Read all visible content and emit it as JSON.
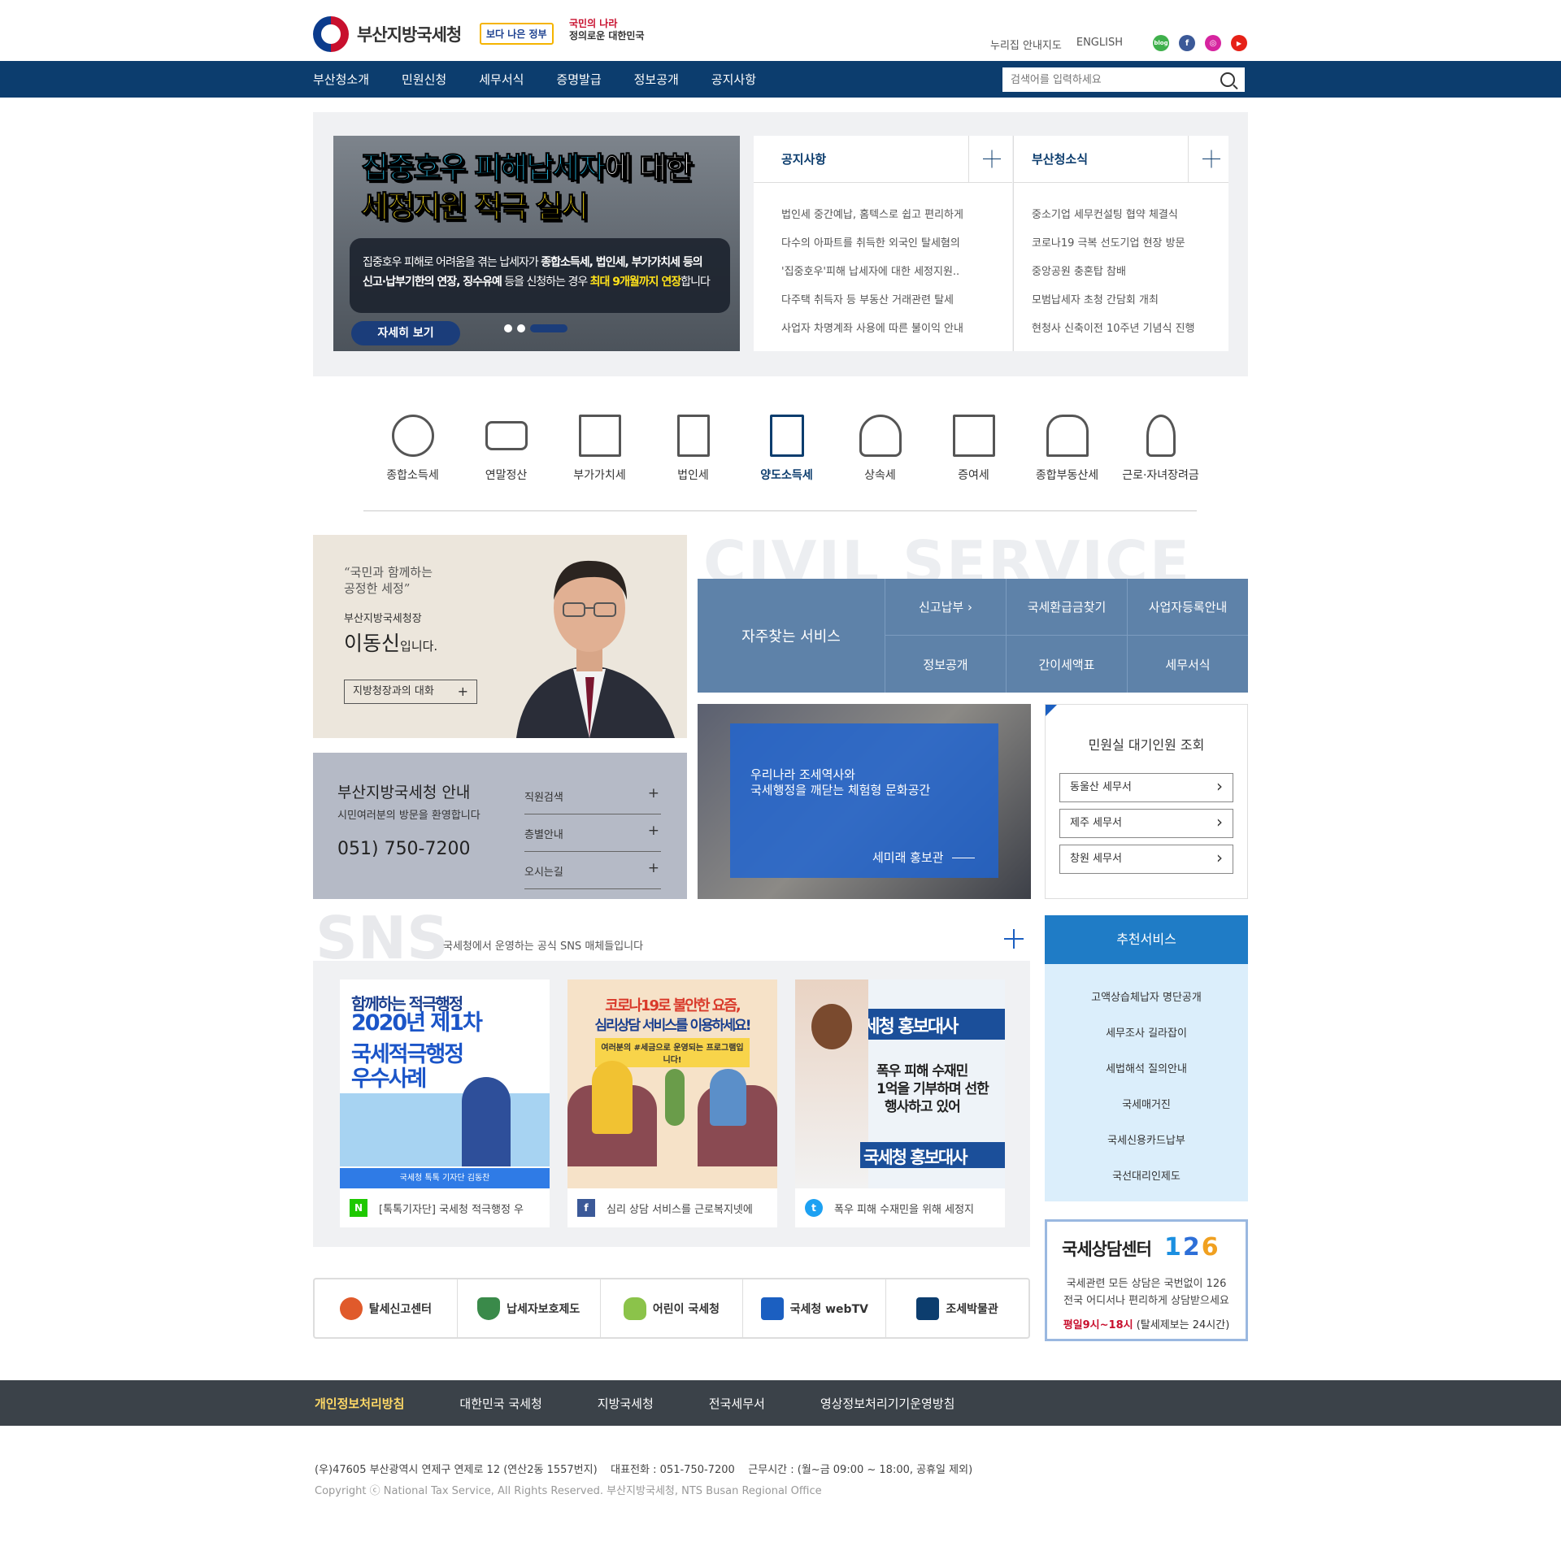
{
  "header": {
    "org_name": "부산지방국세청",
    "slogan1": "보다 나은 정부",
    "slogan2_line1": "국민의 나라",
    "slogan2_line2": "정의로운 대한민국",
    "links": [
      "누리집 안내지도",
      "ENGLISH"
    ],
    "sns": [
      {
        "name": "blog",
        "label": "blog",
        "color": "#3fb04c"
      },
      {
        "name": "facebook",
        "label": "f",
        "color": "#3b5998"
      },
      {
        "name": "instagram",
        "label": "◎",
        "color": "#d6249f"
      },
      {
        "name": "youtube",
        "label": "▶",
        "color": "#e62117"
      }
    ]
  },
  "nav": {
    "items": [
      "부산청소개",
      "민원신청",
      "세무서식",
      "증명발급",
      "정보공개",
      "공지사항"
    ],
    "search_placeholder": "검색어를 입력하세요"
  },
  "banner": {
    "title_part1": "집중호우 피해납세자",
    "title_part2": "에 대한",
    "title_line2": "세정지원 적극 실시",
    "desc_line1_a": "집중호우 피해로 어려움을 겪는 납세자가 ",
    "desc_line1_b": "종합소득세, 법인세, 부가가치세 등의",
    "desc_line2_a": "신고·납부기한의 연장, 징수유예",
    "desc_line2_b": " 등을 신청하는 경우 ",
    "desc_line2_c": "최대 9개월까지 연장",
    "desc_line2_d": "합니다",
    "more_label": "자세히 보기"
  },
  "notice": {
    "title": "공지사항",
    "items": [
      "법인세 중간예납, 홈텍스로 쉽고 편리하게",
      "다수의 아파트를 취득한 외국인 탈세혐의",
      "'집중호우'피해 납세자에 대한 세정지원..",
      "다주택 취득자 등  부동산 거래관련 탈세",
      "사업자 차명계좌 사용에 따른 불이익 안내"
    ]
  },
  "news": {
    "title": "부산청소식",
    "items": [
      "중소기업 세무컨설팅 협약 체결식",
      "코로나19 극복 선도기업 현장 방문",
      "중앙공원 충혼탑 참배",
      "모범납세자 초청 간담회 개최",
      "현청사 신축이전 10주년 기념식 진행"
    ]
  },
  "tax_menu": [
    {
      "label": "종합소득세",
      "icon": "money-bag-icon",
      "active": false
    },
    {
      "label": "연말정산",
      "icon": "card-icon",
      "active": false
    },
    {
      "label": "부가가치세",
      "icon": "store-icon",
      "active": false
    },
    {
      "label": "법인세",
      "icon": "building-icon",
      "active": false
    },
    {
      "label": "양도소득세",
      "icon": "document-icon",
      "active": true
    },
    {
      "label": "상속세",
      "icon": "hand-coin-icon",
      "active": false
    },
    {
      "label": "증여세",
      "icon": "gift-icon",
      "active": false
    },
    {
      "label": "종합부동산세",
      "icon": "house-icon",
      "active": false
    },
    {
      "label": "근로·자녀장려금",
      "icon": "lightbulb-icon",
      "active": false
    }
  ],
  "commissioner": {
    "quote_line1": "“국민과 함께하는",
    "quote_line2": "공정한 세정”",
    "title": "부산지방국세청장",
    "name": "이동신",
    "name_suffix": "입니다.",
    "button": "지방청장과의 대화"
  },
  "civil": {
    "bg_text": "CIVIL SERVICE",
    "label": "자주찾는 서비스",
    "items": [
      "신고납부 ›",
      "국세환급금찾기",
      "사업자등록안내",
      "정보공개",
      "간이세액표",
      "세무서식"
    ]
  },
  "info": {
    "title": "부산지방국세청 안내",
    "subtitle": "시민여러분의 방문을 환영합니다",
    "phone": "051) 750-7200",
    "links": [
      "직원검색",
      "층별안내",
      "오시는길"
    ]
  },
  "museum": {
    "line1": "우리나라 조세역사와",
    "line2": "국세행정을 깨닫는 체험형 문화공간",
    "link": "세미래 홍보관"
  },
  "waiting": {
    "title": "민원실 대기인원 조회",
    "offices": [
      "동울산 세무서",
      "제주 세무서",
      "창원 세무서"
    ]
  },
  "sns": {
    "heading": "SNS",
    "subtitle": "국세청에서 운영하는 공식 SNS 매체들입니다",
    "cards": [
      {
        "platform": "N",
        "color": "#1ec800",
        "caption": "[톡톡기자단] 국세청 적극행정 우",
        "img_line1": "함께하는 적극행정",
        "img_line2": "2020년 제1차",
        "img_line3": "국세적극행정",
        "img_line4": "우수사례",
        "img_footer": "국세청 톡톡 기자단 김동찬"
      },
      {
        "platform": "f",
        "color": "#3b5998",
        "caption": "심리 상담 서비스를 근로복지넷에",
        "img_line1": "코로나19로 불안한 요즘,",
        "img_line2": "심리상담 서비스를 이용하세요!",
        "img_line3": "여러분의 #세금으로 운영되는 프로그램입니다!"
      },
      {
        "platform": "t",
        "color": "#1da1f2",
        "caption": "폭우 피해 수재민을 위해 세정지",
        "img_line1": "국세청 홍보대사",
        "img_line2": "폭우 피해 수재민",
        "img_line3": "1억을 기부하며 선한",
        "img_line4": "행사하고 있어",
        "img_line5": "국세청 홍보대사"
      }
    ]
  },
  "recommend": {
    "title": "추천서비스",
    "items": [
      "고액상습체납자 명단공개",
      "세무조사 길라잡이",
      "세법해석 질의안내",
      "국세매거진",
      "국세신용카드납부",
      "국선대리인제도"
    ]
  },
  "center126": {
    "title": "국세상담센터",
    "number": "126",
    "desc_line1": "국세관련 모든 상담은 국번없이 126",
    "desc_line2": "전국 어디서나 편리하게 상담받으세요",
    "hours": "평일9시~18시",
    "hours_note": " (탈세제보는 24시간)"
  },
  "quick_banners": [
    {
      "label": "탈세신고센터",
      "color": "#e05a2b"
    },
    {
      "label": "납세자보호제도",
      "color": "#3a8a4a"
    },
    {
      "label": "어린이 국세청",
      "color": "#8bc34a"
    },
    {
      "label": "국세청 webTV",
      "color": "#1b5fc1"
    },
    {
      "label": "조세박물관",
      "color": "#0c3d6e"
    }
  ],
  "footer": {
    "links": [
      "개인정보처리방침",
      "대한민국 국세청",
      "지방국세청",
      "전국세무서",
      "영상정보처리기기운영방침"
    ],
    "address": "(우)47605 부산광역시 연제구 연제로 12 (연산2동 1557번지)    대표전화 : 051-750-7200    근무시간 : (월~금 09:00 ~ 18:00, 공휴일 제외)",
    "copyright": "Copyright ⓒ National Tax Service, All Rights Reserved. 부산지방국세청, NTS Busan Regional Office"
  }
}
